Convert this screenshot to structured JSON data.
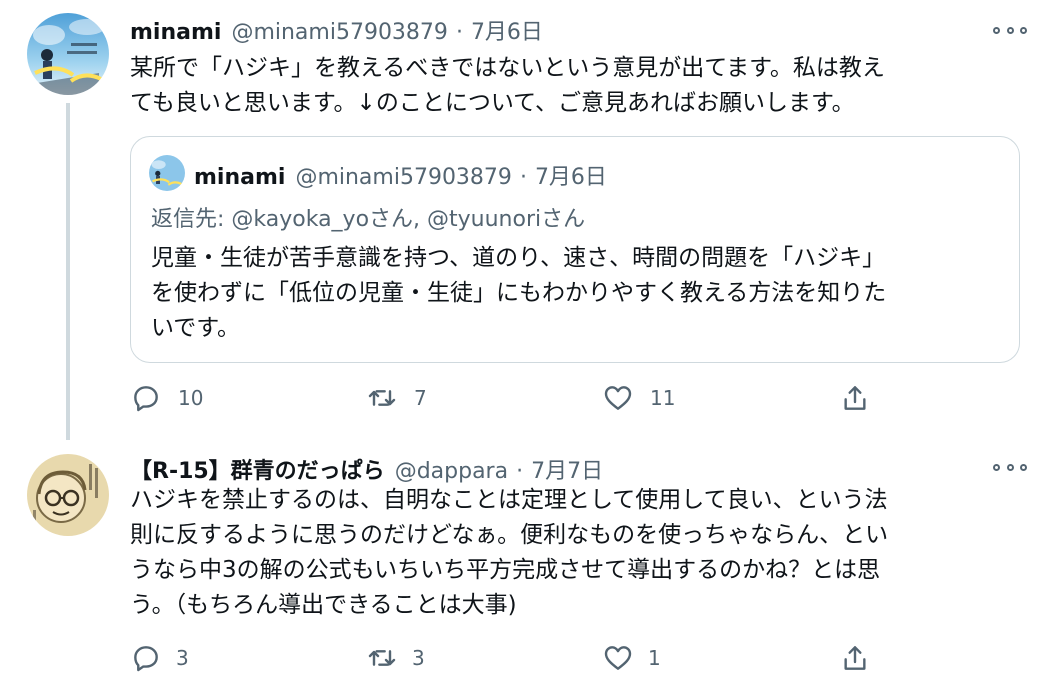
{
  "tweets": [
    {
      "name": "minami",
      "handle": "@minami57903879",
      "separator": "·",
      "date": "7月6日",
      "body_lines": [
        "某所で「ハジキ」を教えるべきではないという意見が出てます。私は教え",
        "ても良いと思います。↓のことについて、ご意見あればお願いします。"
      ],
      "quote": {
        "name": "minami",
        "handle": "@minami57903879",
        "separator": "·",
        "date": "7月6日",
        "reply_to": "返信先: @kayoka_yoさん, @tyuunoriさん",
        "text_lines": [
          "児童・生徒が苦手意識を持つ、道のり、速さ、時間の問題を「ハジキ」",
          "を使わずに「低位の児童・生徒」にもわかりやすく教える方法を知りた",
          "いです。"
        ]
      },
      "actions": {
        "reply_count": "10",
        "retweet_count": "7",
        "like_count": "11"
      }
    },
    {
      "name": "【R-15】群青のだっぱら",
      "handle": "@dappara",
      "separator": "·",
      "date": "7月7日",
      "body_lines": [
        "ハジキを禁止するのは、自明なことは定理として使用して良い、という法",
        "則に反するように思うのだけどなぁ。便利なものを使っちゃならん、とい",
        "うなら中3の解の公式もいちいち平方完成させて導出するのかね？とは思",
        "う。（もちろん導出できることは大事)"
      ],
      "actions": {
        "reply_count": "3",
        "retweet_count": "3",
        "like_count": "1"
      }
    }
  ],
  "icons": {
    "reply": "reply-icon",
    "retweet": "retweet-icon",
    "like": "heart-icon",
    "share": "share-icon",
    "more": "more-icon"
  },
  "colors": {
    "text": "#0f1419",
    "muted": "#536471",
    "border": "#cfd9de"
  }
}
